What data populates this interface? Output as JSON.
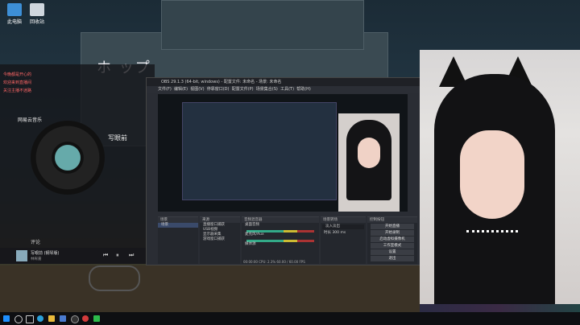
{
  "desktop": {
    "icons": [
      {
        "label": "此电脑",
        "icon": "computer-icon"
      },
      {
        "label": "回收站",
        "icon": "recycle-bin-icon"
      }
    ],
    "wallpaper_sign": "ホ  ップ"
  },
  "music_player": {
    "title": "网易云音乐",
    "song_title": "写眼前",
    "chat_lines": [
      "今晚都是开心的",
      "欢迎来到直播间",
      "关注主播不迷路"
    ],
    "track_label": "评论",
    "now_playing": "写眼前 (钢琴版)",
    "artist": "林宥嘉"
  },
  "obs": {
    "title": "OBS 29.1.3 (64-bit, windows) - 配置文件: 未命名 - 场景: 未命名",
    "menu": [
      "文件(F)",
      "编辑(E)",
      "视图(V)",
      "停靠窗口(D)",
      "配置文件(P)",
      "场景集合(S)",
      "工具(T)",
      "帮助(H)"
    ],
    "panels": {
      "scenes_header": "场景",
      "sources_header": "来源",
      "mixer_header": "音频混音器",
      "transitions_header": "场景转场",
      "controls_header": "控制按钮"
    },
    "scene_items": [
      "场景"
    ],
    "source_items": [
      "直播窗口捕获",
      "USB视频",
      "显示器采集",
      "游戏窗口捕获"
    ],
    "mixer_items": [
      "桌面音频",
      "麦克风/Aux",
      "媒体源"
    ],
    "transition_value": "淡入淡出",
    "duration_label": "时长",
    "duration_value": "300 ms",
    "control_buttons": [
      "开始直播",
      "开始录制",
      "启动虚拟摄像机",
      "工作室模式",
      "设置",
      "退出"
    ],
    "status": "00:00:00  CPU: 2.3%  60.00 / 60.00 FPS"
  },
  "taskbar": {
    "icons": [
      "windows-start-icon",
      "search-icon",
      "taskview-icon",
      "edge-icon",
      "folder-icon",
      "store-icon",
      "obs-icon",
      "music-icon",
      "wechat-icon"
    ],
    "accent": "#1e90ff"
  },
  "colors": {
    "accent_red": "#d23b3b",
    "obs_bg": "#2a2d34",
    "meter_green": "#33aa88"
  }
}
